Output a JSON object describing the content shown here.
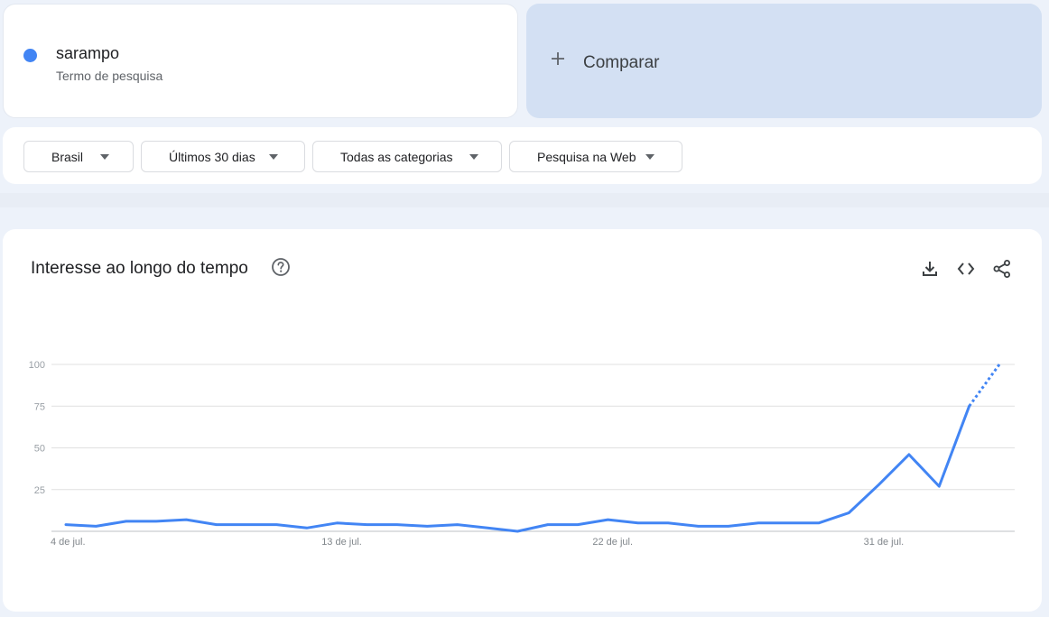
{
  "term": {
    "name": "sarampo",
    "subtitle": "Termo de pesquisa",
    "color": "#4285f4"
  },
  "compare": {
    "label": "Comparar",
    "icon": "plus-icon"
  },
  "filters": [
    {
      "label": "Brasil",
      "icon": "caret-down-icon"
    },
    {
      "label": "Últimos 30 dias",
      "icon": "caret-down-icon"
    },
    {
      "label": "Todas as categorias",
      "icon": "caret-down-icon"
    },
    {
      "label": "Pesquisa na Web",
      "icon": "caret-down-icon"
    }
  ],
  "chart": {
    "title": "Interesse ao longo do tempo",
    "help_icon": "help-circle-icon",
    "tools": [
      "download-icon",
      "embed-code-icon",
      "share-icon"
    ]
  },
  "chart_data": {
    "type": "line",
    "series": [
      {
        "name": "sarampo",
        "color": "#4285f4",
        "values": [
          4,
          3,
          6,
          6,
          7,
          4,
          4,
          4,
          2,
          5,
          4,
          4,
          3,
          4,
          2,
          0,
          4,
          4,
          7,
          5,
          5,
          3,
          3,
          5,
          5,
          5,
          11,
          28,
          46,
          27,
          75,
          100
        ],
        "partial_last_point": true
      }
    ],
    "x_start": "4 de jul.",
    "x_ticks": [
      {
        "label": "4 de jul.",
        "index": 0
      },
      {
        "label": "13 de jul.",
        "index": 9
      },
      {
        "label": "22 de jul.",
        "index": 18
      },
      {
        "label": "31 de jul.",
        "index": 27
      }
    ],
    "y_ticks": [
      25,
      50,
      75,
      100
    ],
    "ylim": [
      0,
      100
    ],
    "grid": true
  }
}
